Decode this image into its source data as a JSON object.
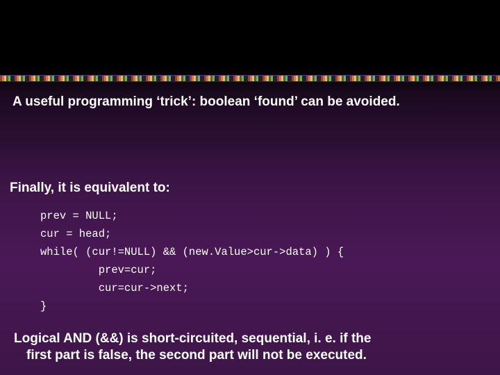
{
  "heading": "A useful programming ‘trick’: boolean ‘found’ can be avoided.",
  "subheading": "Finally, it is equivalent to:",
  "code": {
    "l1": "prev = NULL;",
    "l2": "cur = head;",
    "l3": "while( (cur!=NULL) && (new.Value>cur->data) ) {",
    "l4": "         prev=cur;",
    "l5": "         cur=cur->next;",
    "l6": "}"
  },
  "footnote": {
    "l1": "Logical AND (&&) is short-circuited, sequential, i. e. if the",
    "l2": "first part is false, the second part will not be executed."
  }
}
